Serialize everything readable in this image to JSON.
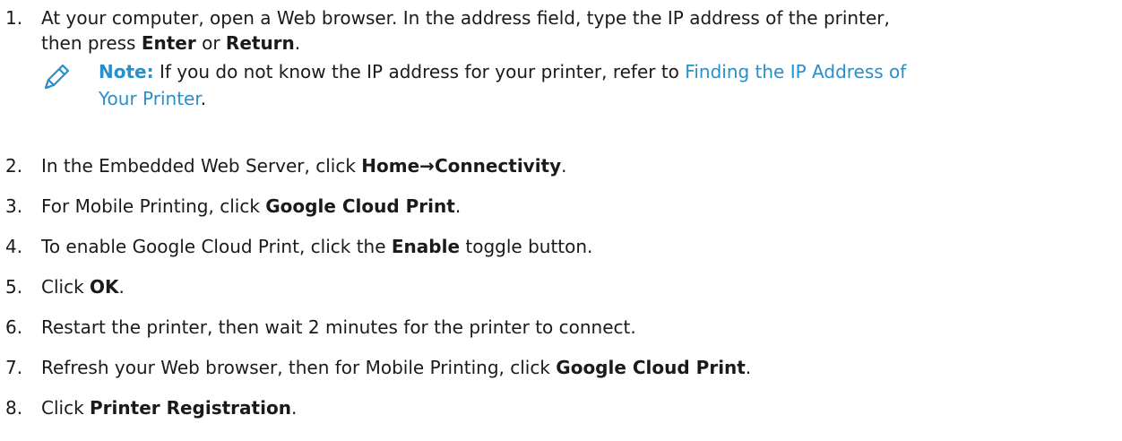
{
  "steps": [
    {
      "num": "1.",
      "line1_a": "At your computer, open a Web browser. In the address field, type the IP address of the printer,",
      "line2_a": "then press ",
      "line2_b1": "Enter",
      "line2_m": " or ",
      "line2_b2": "Return",
      "line2_e": "."
    },
    {
      "num": "2.",
      "a": "In the Embedded Web Server, click ",
      "b": "Home→Connectivity",
      "e": "."
    },
    {
      "num": "3.",
      "a": "For Mobile Printing, click ",
      "b": "Google Cloud Print",
      "e": "."
    },
    {
      "num": "4.",
      "a": "To enable Google Cloud Print, click the ",
      "b": "Enable",
      "e": " toggle button."
    },
    {
      "num": "5.",
      "a": "Click ",
      "b": "OK",
      "e": "."
    },
    {
      "num": "6.",
      "a": "Restart the printer, then wait 2 minutes for the printer to connect."
    },
    {
      "num": "7.",
      "a": "Refresh your Web browser, then for Mobile Printing, click ",
      "b": "Google Cloud Print",
      "e": "."
    },
    {
      "num": "8.",
      "a": "Click ",
      "b": "Printer Registration",
      "e": "."
    }
  ],
  "note": {
    "icon": "pencil-icon",
    "label": "Note:",
    "text": " If you do not know the IP address for your printer, refer to ",
    "link_line1": "Finding the IP Address of",
    "link_line2": "Your Printer",
    "end": "."
  },
  "colors": {
    "text": "#1a1a1a",
    "accent": "#2a8fc9"
  }
}
